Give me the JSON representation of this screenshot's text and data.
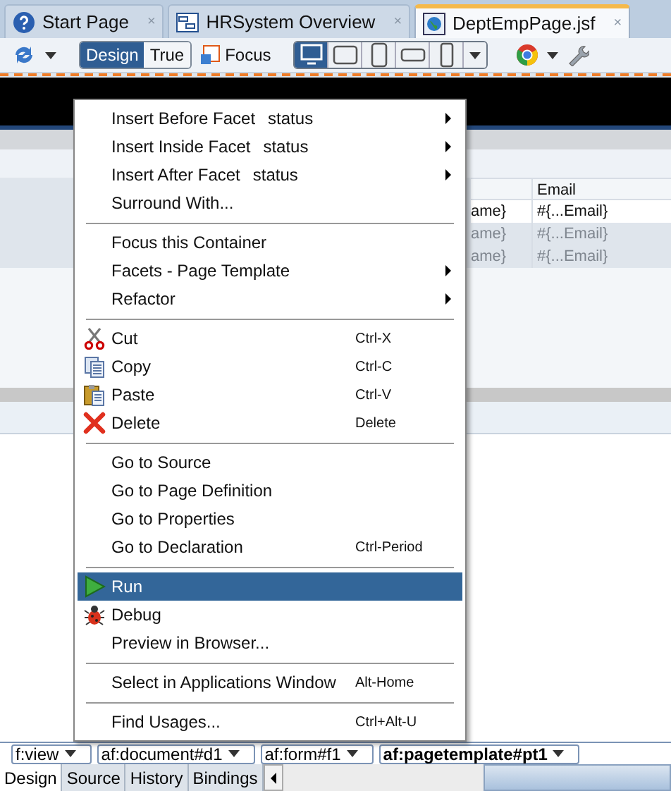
{
  "editor_tabs": [
    {
      "label": "Start Page",
      "close": "×",
      "selected": false
    },
    {
      "label": "HRSystem Overview",
      "close": "×",
      "selected": false
    },
    {
      "label": "DeptEmpPage.jsf",
      "close": "×",
      "selected": true
    }
  ],
  "toolbar": {
    "modes": [
      {
        "label": "Design",
        "selected": true
      },
      {
        "label": "True",
        "selected": false
      }
    ],
    "focus_label": "Focus",
    "devices": [
      {
        "selected": true
      },
      {
        "selected": false
      },
      {
        "selected": false
      },
      {
        "selected": false
      },
      {
        "selected": false
      }
    ]
  },
  "table": {
    "columns": [
      "Email"
    ],
    "rows": [
      {
        "column_1": "ame}",
        "email": "#{...Email}",
        "faded": false
      },
      {
        "column_1": "ame}",
        "email": "#{...Email}",
        "faded": true
      },
      {
        "column_1": "ame}",
        "email": "#{...Email}",
        "faded": true
      }
    ]
  },
  "context_menu": {
    "groups": [
      [
        {
          "label": "Insert Before Facet",
          "detail": "status",
          "submenu": true,
          "selected": false
        },
        {
          "label": "Insert Inside Facet",
          "detail": "status",
          "submenu": true,
          "selected": false
        },
        {
          "label": "Insert After Facet",
          "detail": "status",
          "submenu": true,
          "selected": false
        },
        {
          "label": "Surround With...",
          "submenu": false,
          "selected": false
        }
      ],
      [
        {
          "label": "Focus this Container",
          "submenu": false,
          "selected": false
        },
        {
          "label": "Facets - Page Template",
          "submenu": true,
          "selected": false
        },
        {
          "label": "Refactor",
          "submenu": true,
          "selected": false
        }
      ],
      [
        {
          "label": "Cut",
          "shortcut": "Ctrl-X",
          "submenu": false,
          "selected": false
        },
        {
          "label": "Copy",
          "shortcut": "Ctrl-C",
          "submenu": false,
          "selected": false
        },
        {
          "label": "Paste",
          "shortcut": "Ctrl-V",
          "submenu": false,
          "selected": false
        },
        {
          "label": "Delete",
          "shortcut": "Delete",
          "submenu": false,
          "selected": false
        }
      ],
      [
        {
          "label": "Go to Source",
          "submenu": false,
          "selected": false
        },
        {
          "label": "Go to Page Definition",
          "submenu": false,
          "selected": false
        },
        {
          "label": "Go to Properties",
          "submenu": false,
          "selected": false
        },
        {
          "label": "Go to Declaration",
          "shortcut": "Ctrl-Period",
          "submenu": false,
          "selected": false
        }
      ],
      [
        {
          "label": "Run",
          "submenu": false,
          "selected": true
        },
        {
          "label": "Debug",
          "submenu": false,
          "selected": false
        },
        {
          "label": "Preview in Browser...",
          "submenu": false,
          "selected": false
        }
      ],
      [
        {
          "label": "Select in Applications Window",
          "shortcut": "Alt-Home",
          "submenu": false,
          "selected": false
        }
      ],
      [
        {
          "label": "Find Usages...",
          "shortcut": "Ctrl+Alt-U",
          "submenu": false,
          "selected": false
        }
      ]
    ]
  },
  "breadcrumb": [
    {
      "label": "f:view",
      "current": false
    },
    {
      "label": "af:document#d1",
      "current": false
    },
    {
      "label": "af:form#f1",
      "current": false
    },
    {
      "label": "af:pagetemplate#pt1",
      "current": true
    }
  ],
  "bottom_tabs": [
    {
      "label": "Design",
      "selected": true
    },
    {
      "label": "Source",
      "selected": false
    },
    {
      "label": "History",
      "selected": false
    },
    {
      "label": "Bindings",
      "selected": false
    }
  ]
}
